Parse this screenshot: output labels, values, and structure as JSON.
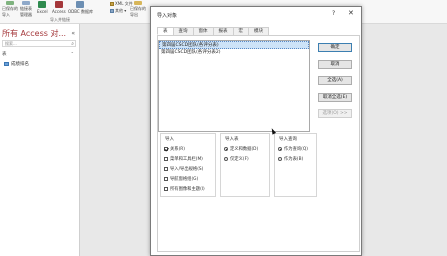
{
  "ribbon": {
    "buttons": [
      {
        "label": "已保存的\n导入"
      },
      {
        "label": "链接表\n管理器"
      },
      {
        "label": "Excel"
      },
      {
        "label": "Access"
      },
      {
        "label": "ODBC 数据库"
      }
    ],
    "xml_label": "XML 文件",
    "other_label": "其他 ▾",
    "group_import": "导入并链接",
    "group_export_partial": "已保存的\n导出"
  },
  "nav": {
    "title": "所有 Access 对...",
    "search_placeholder": "搜索...",
    "group_label": "表",
    "items": [
      {
        "label": "成绩排名"
      }
    ]
  },
  "dialog": {
    "title": "导入对象",
    "help": "?",
    "close": "✕",
    "tabs": [
      "表",
      "查询",
      "窗体",
      "报表",
      "宏",
      "模块"
    ],
    "active_tab": "表",
    "list_items": [
      {
        "label": "第四届CSCD团队(各评分表)",
        "selected": true
      },
      {
        "label": "第四届CSCD团队(各评分表2)",
        "selected": false
      }
    ],
    "buttons": {
      "ok": "确定",
      "cancel": "取消",
      "select_all": "全选(A)",
      "deselect_all": "取消全选(E)",
      "options": "选项(O) >>"
    },
    "import_group": {
      "title": "导入",
      "options": [
        {
          "label": "关系(R)",
          "checked": true
        },
        {
          "label": "菜单和工具栏(M)",
          "checked": false
        },
        {
          "label": "导入/导出规格(S)",
          "checked": false
        },
        {
          "label": "导航窗格组(G)",
          "checked": false
        },
        {
          "label": "所有图像和主题(I)",
          "checked": false
        }
      ]
    },
    "import_tables_group": {
      "title": "导入表",
      "options": [
        {
          "label": "定义和数据(D)",
          "selected": true
        },
        {
          "label": "仅定义(F)",
          "selected": false
        }
      ]
    },
    "import_queries_group": {
      "title": "导入查询",
      "options": [
        {
          "label": "作为查询(Q)",
          "selected": true
        },
        {
          "label": "作为表(B)",
          "selected": false
        }
      ]
    }
  }
}
